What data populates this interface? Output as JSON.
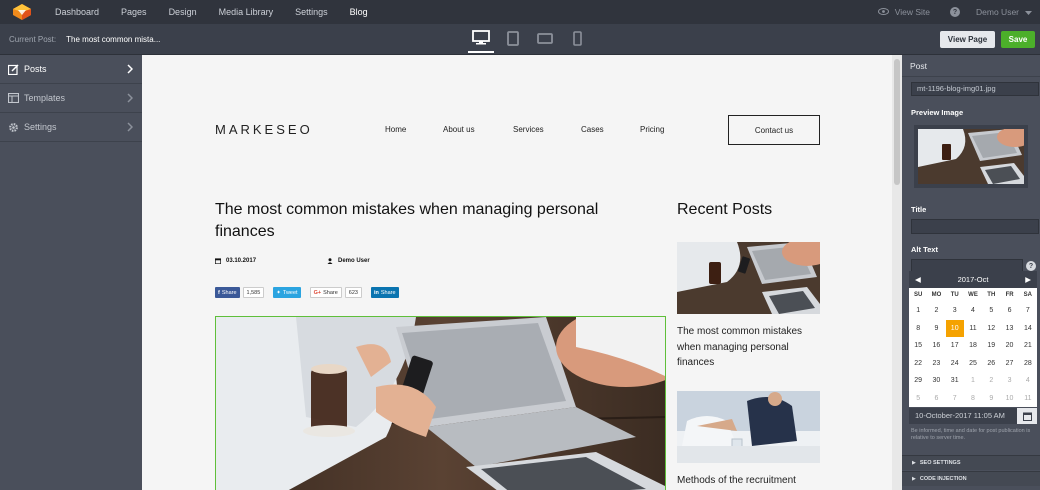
{
  "topnav": {
    "items": [
      "Dashboard",
      "Pages",
      "Design",
      "Media Library",
      "Settings",
      "Blog"
    ],
    "active": "Blog",
    "view_site": "View Site",
    "help": "?",
    "user": "Demo User"
  },
  "subbar": {
    "current_post_label": "Current Post:",
    "current_post_value": "The most common mista...",
    "devices": [
      "desktop",
      "tablet-portrait",
      "tablet-landscape",
      "phone"
    ],
    "view_page": "View Page",
    "save": "Save"
  },
  "sidebar": {
    "items": [
      {
        "label": "Posts",
        "icon": "edit-icon",
        "active": true
      },
      {
        "label": "Templates",
        "icon": "template-icon",
        "active": false
      },
      {
        "label": "Settings",
        "icon": "gear-icon",
        "active": false
      }
    ]
  },
  "site": {
    "brand": "MARKESEO",
    "nav": [
      "Home",
      "About us",
      "Services",
      "Cases",
      "Pricing"
    ],
    "contact": "Contact us",
    "post_title": "The most common mistakes when managing personal finances",
    "date": "03.10.2017",
    "author": "Demo User",
    "share": {
      "fb_label": "Share",
      "fb_count": "1,585",
      "tw_label": "Tweet",
      "gp_label": "Share",
      "gp_count": "623",
      "li_label": "Share"
    },
    "recent_title": "Recent Posts",
    "recent": [
      "The most common mistakes when managing personal finances",
      "Methods of the recruitment"
    ]
  },
  "panel": {
    "header": "Post",
    "filename": "mt-1196-blog-img01.jpg",
    "preview_label": "Preview Image",
    "title_label": "Title",
    "title_value": "",
    "alt_label": "Alt Text",
    "alt_value": "",
    "calendar": {
      "month": "2017-Oct",
      "dow": [
        "SU",
        "MO",
        "TU",
        "WE",
        "TH",
        "FR",
        "SA"
      ],
      "weeks": [
        [
          "1",
          "2",
          "3",
          "4",
          "5",
          "6",
          "7"
        ],
        [
          "8",
          "9",
          "10",
          "11",
          "12",
          "13",
          "14"
        ],
        [
          "15",
          "16",
          "17",
          "18",
          "19",
          "20",
          "21"
        ],
        [
          "22",
          "23",
          "24",
          "25",
          "26",
          "27",
          "28"
        ],
        [
          "29",
          "30",
          "31",
          "1",
          "2",
          "3",
          "4"
        ],
        [
          "5",
          "6",
          "7",
          "8",
          "9",
          "10",
          "11"
        ]
      ],
      "selected": "10"
    },
    "datetime": "10-October-2017 11:05 AM",
    "note": "Be informed, time and date for post publication is relative to server time.",
    "accordions": [
      "SEO SETTINGS",
      "CODE INJECTION"
    ]
  },
  "colors": {
    "accent_green": "#4caf2a",
    "selected_day": "#f5a200",
    "hero_border": "#5fbf3a"
  }
}
